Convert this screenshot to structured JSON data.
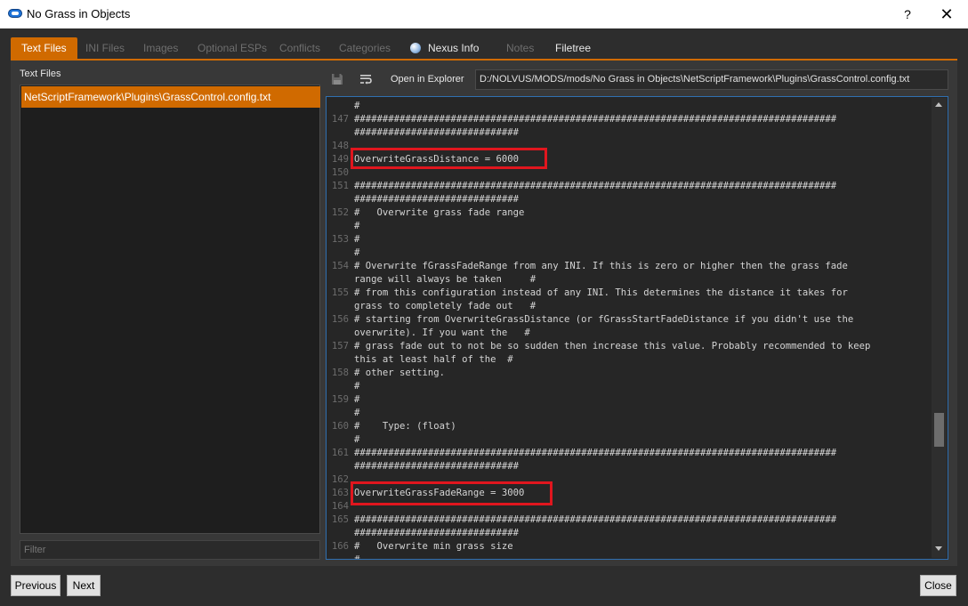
{
  "window": {
    "title": "No Grass in Objects",
    "help_label": "?",
    "close_label": "✕"
  },
  "tabs": [
    {
      "label": "Text Files"
    },
    {
      "label": "INI Files"
    },
    {
      "label": "Images"
    },
    {
      "label": "Optional ESPs"
    },
    {
      "label": "Conflicts"
    },
    {
      "label": "Categories"
    },
    {
      "label": "Nexus Info"
    },
    {
      "label": "Notes"
    },
    {
      "label": "Filetree"
    }
  ],
  "sidebar": {
    "label": "Text Files",
    "files": [
      "NetScriptFramework\\Plugins\\GrassControl.config.txt"
    ],
    "filter_placeholder": "Filter"
  },
  "toolbar": {
    "save_icon": "floppy-disk-icon",
    "wrap_icon": "word-wrap-icon",
    "open_explorer_label": "Open in Explorer",
    "path": "D:/NOLVUS/MODS/mods/No Grass in Objects\\NetScriptFramework\\Plugins\\GrassControl.config.txt"
  },
  "editor": {
    "lines": [
      {
        "num": "",
        "text": "#"
      },
      {
        "num": "147",
        "text": "#####################################################################################"
      },
      {
        "num": "",
        "text": "#############################"
      },
      {
        "num": "148",
        "text": ""
      },
      {
        "num": "149",
        "text": "OverwriteGrassDistance = 6000"
      },
      {
        "num": "150",
        "text": ""
      },
      {
        "num": "151",
        "text": "#####################################################################################"
      },
      {
        "num": "",
        "text": "#############################"
      },
      {
        "num": "152",
        "text": "#   Overwrite grass fade range"
      },
      {
        "num": "",
        "text": "#"
      },
      {
        "num": "153",
        "text": "#"
      },
      {
        "num": "",
        "text": "#"
      },
      {
        "num": "154",
        "text": "# Overwrite fGrassFadeRange from any INI. If this is zero or higher then the grass fade"
      },
      {
        "num": "",
        "text": "range will always be taken     #"
      },
      {
        "num": "155",
        "text": "# from this configuration instead of any INI. This determines the distance it takes for"
      },
      {
        "num": "",
        "text": "grass to completely fade out   #"
      },
      {
        "num": "156",
        "text": "# starting from OverwriteGrassDistance (or fGrassStartFadeDistance if you didn't use the"
      },
      {
        "num": "",
        "text": "overwrite). If you want the   #"
      },
      {
        "num": "157",
        "text": "# grass fade out to not be so sudden then increase this value. Probably recommended to keep"
      },
      {
        "num": "",
        "text": "this at least half of the  #"
      },
      {
        "num": "158",
        "text": "# other setting."
      },
      {
        "num": "",
        "text": "#"
      },
      {
        "num": "159",
        "text": "#"
      },
      {
        "num": "",
        "text": "#"
      },
      {
        "num": "160",
        "text": "#    Type: (float)"
      },
      {
        "num": "",
        "text": "#"
      },
      {
        "num": "161",
        "text": "#####################################################################################"
      },
      {
        "num": "",
        "text": "#############################"
      },
      {
        "num": "162",
        "text": ""
      },
      {
        "num": "163",
        "text": "OverwriteGrassFadeRange = 3000"
      },
      {
        "num": "164",
        "text": ""
      },
      {
        "num": "165",
        "text": "#####################################################################################"
      },
      {
        "num": "",
        "text": "#############################"
      },
      {
        "num": "166",
        "text": "#   Overwrite min grass size"
      },
      {
        "num": "",
        "text": "#"
      }
    ],
    "highlight_color": "#e0161e"
  },
  "footer": {
    "previous_label": "Previous",
    "next_label": "Next",
    "close_label": "Close"
  },
  "colors": {
    "accent": "#d06a00",
    "background": "#2f2f2f",
    "editor_border": "#2f6fb0"
  }
}
